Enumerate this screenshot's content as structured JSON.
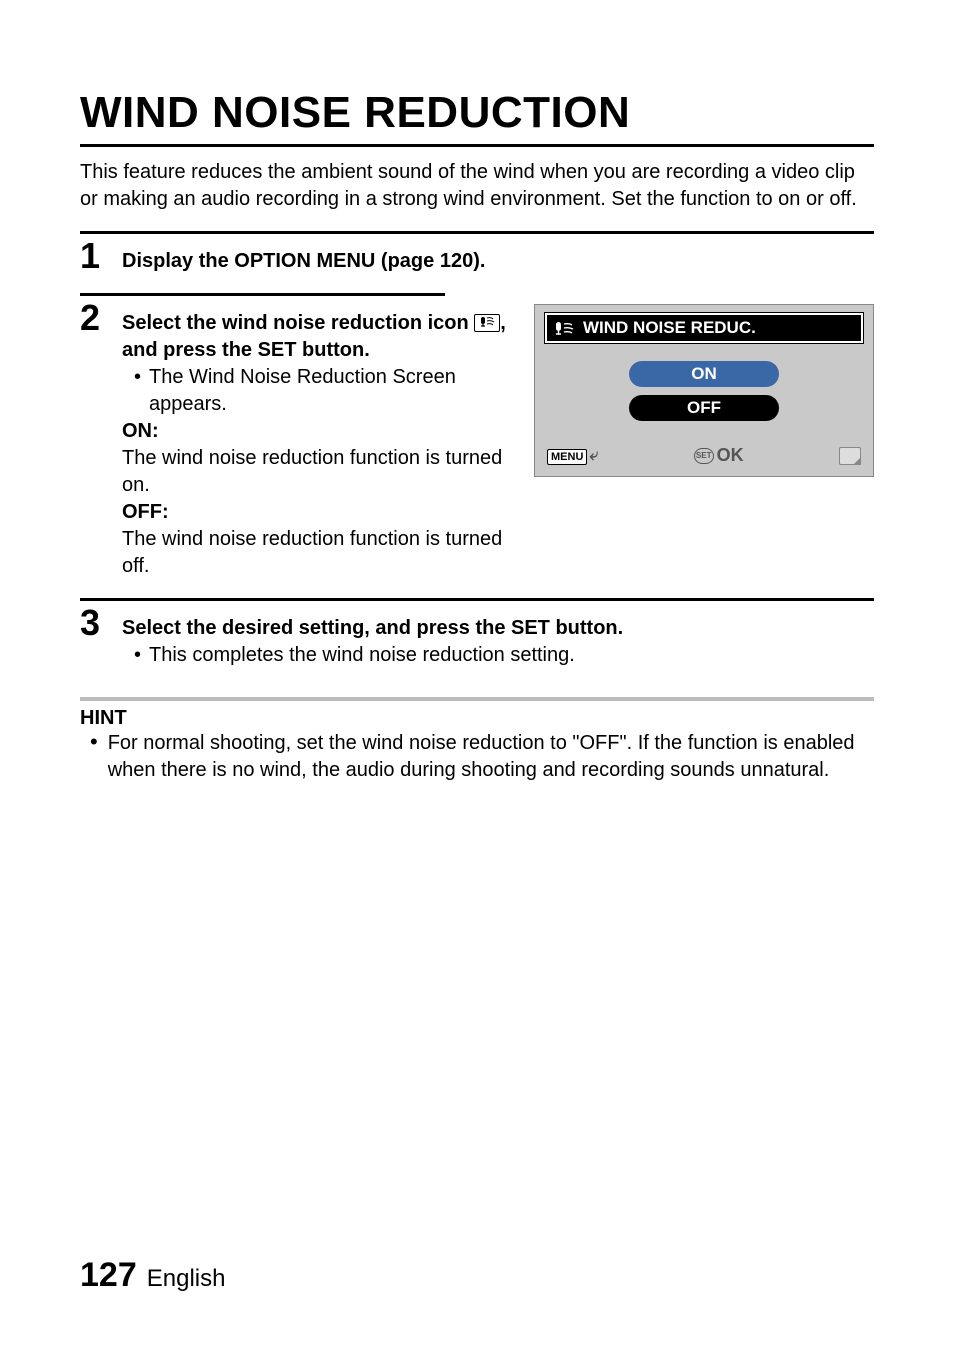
{
  "title": "WIND NOISE REDUCTION",
  "intro": "This feature reduces the ambient sound of the wind when you are recording a video clip or making an audio recording in a strong wind environment. Set the function to on or off.",
  "steps": {
    "s1": {
      "num": "1",
      "head": "Display the OPTION MENU (page 120)."
    },
    "s2": {
      "num": "2",
      "head_a": "Select the wind noise reduction icon ",
      "head_b": ", and press the SET button.",
      "bullet": "The Wind Noise Reduction Screen appears.",
      "on_label": "ON:",
      "on_text": "The wind noise reduction function is turned on.",
      "off_label": "OFF:",
      "off_text": "The wind noise reduction function is turned off."
    },
    "s3": {
      "num": "3",
      "head": "Select the desired setting, and press the SET button.",
      "bullet": "This completes the wind noise reduction setting."
    }
  },
  "screen": {
    "title": "WIND NOISE REDUC.",
    "on": "ON",
    "off": "OFF",
    "menu": "MENU",
    "set": "SET",
    "ok": "OK"
  },
  "hint": {
    "title": "HINT",
    "text": "For normal shooting, set the wind noise reduction to \"OFF\". If the function is enabled when there is no wind, the audio during shooting and recording sounds unnatural."
  },
  "footer": {
    "page": "127",
    "lang": "English"
  }
}
